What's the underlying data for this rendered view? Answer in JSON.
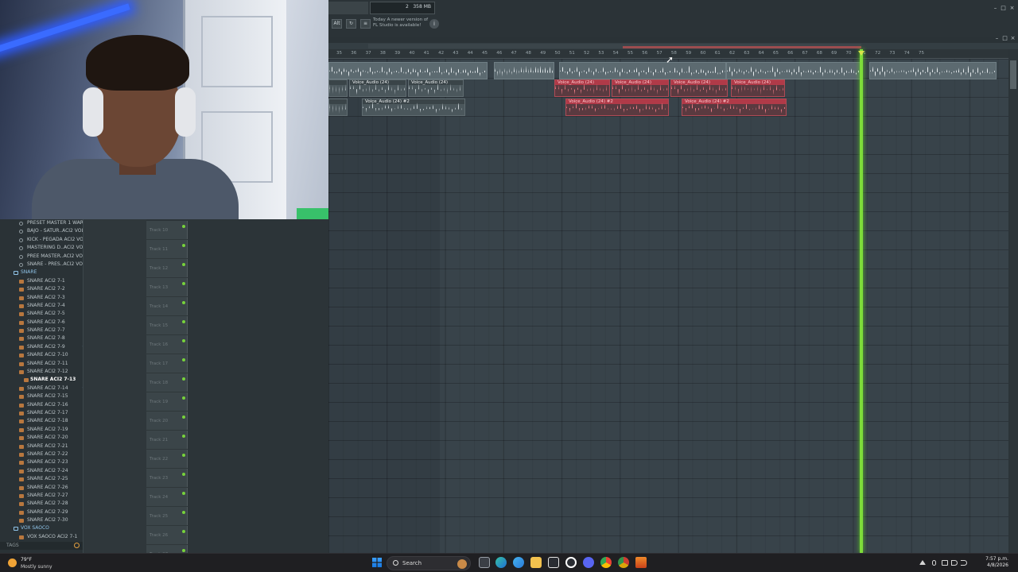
{
  "toolbar": {
    "memory": "358 MB",
    "cpu": "2",
    "notice_line1": "Today A newer version of",
    "notice_line2": "FL Studio is available!",
    "alt_label": "Alt",
    "notice_icon": "info-icon"
  },
  "ruler": {
    "ticks": [
      "35",
      "36",
      "37",
      "38",
      "39",
      "40",
      "41",
      "42",
      "43",
      "44",
      "45",
      "46",
      "47",
      "48",
      "49",
      "50",
      "51",
      "52",
      "53",
      "54",
      "55",
      "56",
      "57",
      "58",
      "59",
      "60",
      "61",
      "62",
      "63",
      "64",
      "65",
      "66",
      "67",
      "68",
      "69",
      "70",
      "71",
      "72",
      "73",
      "74",
      "75"
    ]
  },
  "clips": {
    "voice_a": "Voice_Audio (24)",
    "voice_b": "Voice_Audio (24)",
    "voice_c": "Voice_Audio (24) #2",
    "voice_d": "Voice_Audio (24)",
    "voice_e": "Voice_Audio (24)",
    "voice_f": "Voice_Audio (24)",
    "voice_g": "Voice_Audio (24)",
    "voice_h": "Voice_Audio (24) #2",
    "voice_i": "Voice_Audio (24) #2"
  },
  "tracks": [
    "Track 10",
    "Track 11",
    "Track 12",
    "Track 13",
    "Track 14",
    "Track 15",
    "Track 16",
    "Track 17",
    "Track 18",
    "Track 19",
    "Track 20",
    "Track 21",
    "Track 22",
    "Track 23",
    "Track 24",
    "Track 25",
    "Track 26",
    "Track 27"
  ],
  "browser": {
    "items": [
      {
        "label": "PRESET MASTER 1 WARK",
        "kind": "preset"
      },
      {
        "label": "BAJO - SATUR..ACI2 VOL 7",
        "kind": "preset"
      },
      {
        "label": "KICK - PEGADA ACI2 VOL 7",
        "kind": "preset"
      },
      {
        "label": "MASTERING D..ACI2 VOL 7",
        "kind": "preset"
      },
      {
        "label": "PREE MASTER..ACI2 VOL 7",
        "kind": "preset"
      },
      {
        "label": "SNARE - PRES..ACI2 VOL 7",
        "kind": "preset"
      },
      {
        "label": "SNARE",
        "kind": "folder"
      },
      {
        "label": "SNARE ACI2 7-1",
        "kind": "file"
      },
      {
        "label": "SNARE ACI2 7-2",
        "kind": "file"
      },
      {
        "label": "SNARE ACI2 7-3",
        "kind": "file"
      },
      {
        "label": "SNARE ACI2 7-4",
        "kind": "file"
      },
      {
        "label": "SNARE ACI2 7-5",
        "kind": "file"
      },
      {
        "label": "SNARE ACI2 7-6",
        "kind": "file"
      },
      {
        "label": "SNARE ACI2 7-7",
        "kind": "file"
      },
      {
        "label": "SNARE ACI2 7-8",
        "kind": "file"
      },
      {
        "label": "SNARE ACI2 7-9",
        "kind": "file",
        "star": "★"
      },
      {
        "label": "SNARE ACI2 7-10",
        "kind": "file"
      },
      {
        "label": "SNARE ACI2 7-11",
        "kind": "file"
      },
      {
        "label": "SNARE ACI2 7-12",
        "kind": "file"
      },
      {
        "label": "SNARE ACI2 7-13",
        "kind": "active"
      },
      {
        "label": "SNARE ACI2 7-14",
        "kind": "file",
        "star": "★"
      },
      {
        "label": "SNARE ACI2 7-15",
        "kind": "file"
      },
      {
        "label": "SNARE ACI2 7-16",
        "kind": "file"
      },
      {
        "label": "SNARE ACI2 7-17",
        "kind": "file"
      },
      {
        "label": "SNARE ACI2 7-18",
        "kind": "file"
      },
      {
        "label": "SNARE ACI2 7-19",
        "kind": "file"
      },
      {
        "label": "SNARE ACI2 7-20",
        "kind": "file"
      },
      {
        "label": "SNARE ACI2 7-21",
        "kind": "file"
      },
      {
        "label": "SNARE ACI2 7-22",
        "kind": "file"
      },
      {
        "label": "SNARE ACI2 7-23",
        "kind": "file"
      },
      {
        "label": "SNARE ACI2 7-24",
        "kind": "file"
      },
      {
        "label": "SNARE ACI2 7-25",
        "kind": "file"
      },
      {
        "label": "SNARE ACI2 7-26",
        "kind": "file"
      },
      {
        "label": "SNARE ACI2 7-27",
        "kind": "file"
      },
      {
        "label": "SNARE ACI2 7-28",
        "kind": "file"
      },
      {
        "label": "SNARE ACI2 7-29",
        "kind": "file"
      },
      {
        "label": "SNARE ACI2 7-30",
        "kind": "file"
      },
      {
        "label": "VOX SAOCO",
        "kind": "folder"
      },
      {
        "label": "VOX SAOCO ACI2 7-1",
        "kind": "file"
      }
    ],
    "search_label": "TAGS"
  },
  "taskbar": {
    "temperature": "79°F",
    "weather": "Mostly sunny",
    "search_placeholder": "Search",
    "time": "7:57 p.m.",
    "date": "4/8/2026"
  },
  "colors": {
    "playhead": "#7ddc3a",
    "clip_red": "#b03a48",
    "accent_blue": "#3a6bff"
  }
}
